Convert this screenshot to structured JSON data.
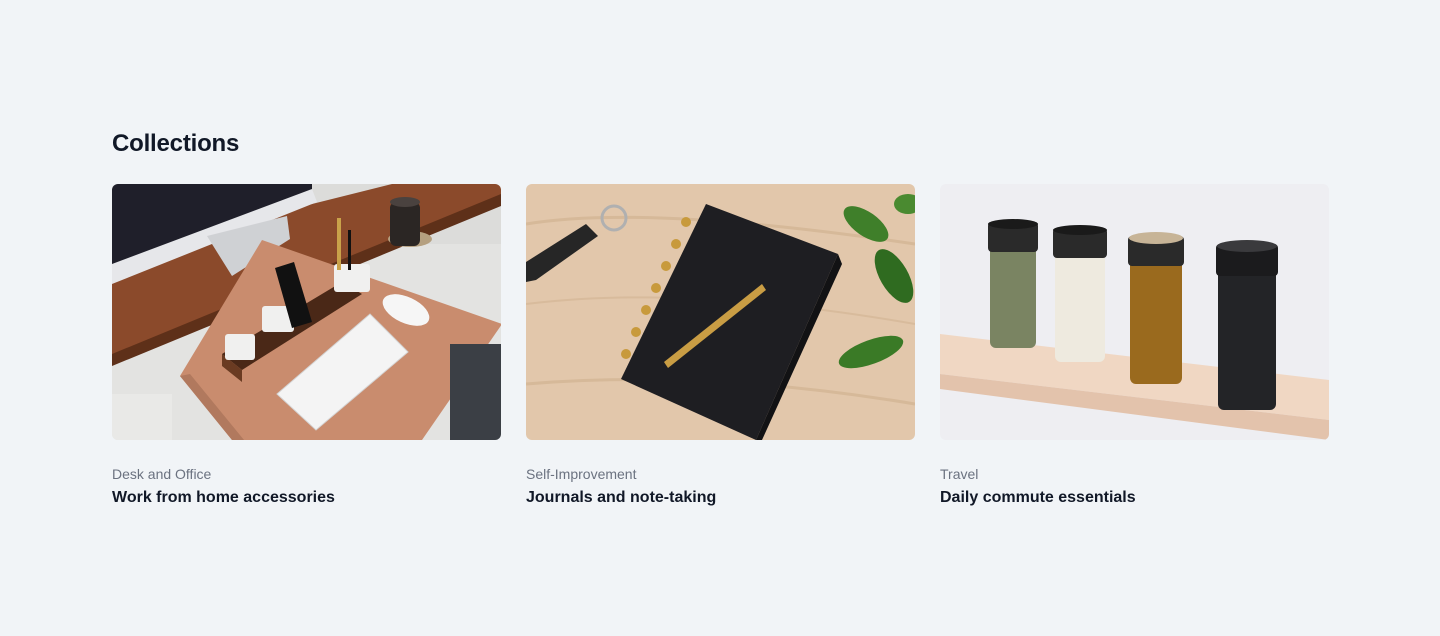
{
  "section": {
    "title": "Collections"
  },
  "collections": [
    {
      "category": "Desk and Office",
      "name": "Work from home accessories",
      "image": "desk-office-photo"
    },
    {
      "category": "Self-Improvement",
      "name": "Journals and note-taking",
      "image": "journal-photo"
    },
    {
      "category": "Travel",
      "name": "Daily commute essentials",
      "image": "travel-bottles-photo"
    }
  ],
  "colors": {
    "background": "#f1f4f7",
    "heading": "#111827",
    "category": "#6b7280"
  }
}
